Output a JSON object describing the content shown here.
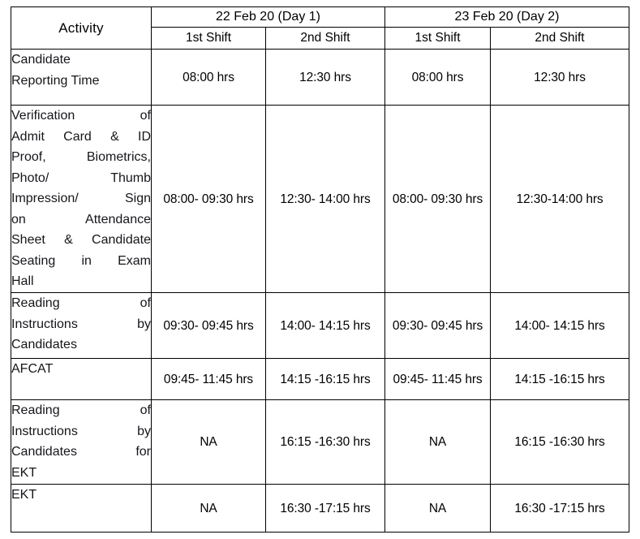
{
  "table": {
    "headers": {
      "activity": "Activity",
      "day1": "22 Feb 20 (Day 1)",
      "day2": "23 Feb 20 (Day 2)",
      "day1_shift1": "1st Shift",
      "day1_shift2": "2nd Shift",
      "day2_shift1": "1st Shift",
      "day2_shift2": "2nd Shift"
    },
    "rows": [
      {
        "id": "candidate-reporting-time",
        "activity_lines": [
          "Candidate",
          "Reporting Time"
        ],
        "justified": false,
        "day1_shift1": "08:00 hrs",
        "day1_shift2": "12:30 hrs",
        "day2_shift1": "08:00 hrs",
        "day2_shift2": "12:30 hrs"
      },
      {
        "id": "verification",
        "activity_lines": [
          "Verification of",
          "Admit Card & ID",
          "Proof, Biometrics,",
          "Photo/ Thumb",
          "Impression/ Sign",
          "on Attendance",
          "Sheet & Candidate",
          "Seating in Exam",
          "Hall"
        ],
        "justified": true,
        "day1_shift1": "08:00- 09:30 hrs",
        "day1_shift2": "12:30- 14:00 hrs",
        "day2_shift1": "08:00- 09:30 hrs",
        "day2_shift2": "12:30-14:00 hrs"
      },
      {
        "id": "reading-instructions",
        "activity_lines": [
          "Reading of",
          "Instructions by",
          "Candidates"
        ],
        "justified": true,
        "day1_shift1": "09:30- 09:45 hrs",
        "day1_shift2": "14:00- 14:15 hrs",
        "day2_shift1": "09:30- 09:45 hrs",
        "day2_shift2": "14:00- 14:15 hrs"
      },
      {
        "id": "afcat",
        "activity_lines": [
          "AFCAT"
        ],
        "justified": false,
        "day1_shift1": "09:45- 11:45 hrs",
        "day1_shift2": "14:15 -16:15 hrs",
        "day2_shift1": "09:45- 11:45 hrs",
        "day2_shift2": "14:15 -16:15 hrs"
      },
      {
        "id": "reading-instructions-ekt",
        "activity_lines": [
          "Reading of",
          "Instructions by",
          "Candidates for",
          "EKT"
        ],
        "justified": true,
        "day1_shift1": "NA",
        "day1_shift2": "16:15 -16:30 hrs",
        "day2_shift1": "NA",
        "day2_shift2": "16:15 -16:30 hrs"
      },
      {
        "id": "ekt",
        "activity_lines": [
          "EKT"
        ],
        "justified": false,
        "day1_shift1": "NA",
        "day1_shift2": "16:30 -17:15 hrs",
        "day2_shift1": "NA",
        "day2_shift2": "16:30 -17:15 hrs"
      }
    ]
  },
  "style": {
    "border_color": "#000000",
    "text_color": "#000000",
    "activity_text_color": "#15161a",
    "background": "#ffffff"
  }
}
